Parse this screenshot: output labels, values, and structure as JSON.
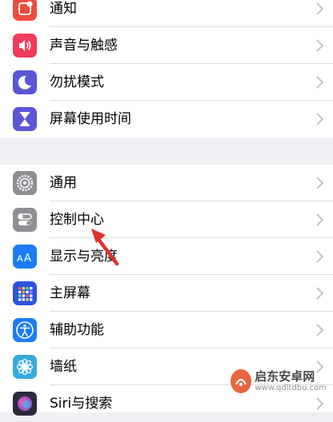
{
  "colors": {
    "notifications": "#f04b3d",
    "sounds": "#f03b5c",
    "dnd": "#5a56d6",
    "screen_time": "#5a56d6",
    "general": "#8e8e93",
    "control_center": "#8e8e93",
    "display": "#1b7cf5",
    "home_screen": "#2c55e0",
    "accessibility": "#1b7cf5",
    "wallpaper": "#35aadc",
    "siri": "#2a2a3a",
    "annotation_arrow": "#e0302a"
  },
  "group1": {
    "items": [
      {
        "label": "通知",
        "icon": "notifications-icon"
      },
      {
        "label": "声音与触感",
        "icon": "speaker-icon"
      },
      {
        "label": "勿扰模式",
        "icon": "moon-icon"
      },
      {
        "label": "屏幕使用时间",
        "icon": "hourglass-icon"
      }
    ]
  },
  "group2": {
    "items": [
      {
        "label": "通用",
        "icon": "gear-icon"
      },
      {
        "label": "控制中心",
        "icon": "toggles-icon"
      },
      {
        "label": "显示与亮度",
        "icon": "text-size-icon"
      },
      {
        "label": "主屏幕",
        "icon": "home-grid-icon"
      },
      {
        "label": "辅助功能",
        "icon": "accessibility-icon"
      },
      {
        "label": "墙纸",
        "icon": "flower-icon"
      },
      {
        "label": "Siri与搜索",
        "icon": "siri-icon"
      }
    ]
  },
  "watermark": {
    "title": "启东安卓网",
    "url": "www.qdltdbu.com"
  }
}
